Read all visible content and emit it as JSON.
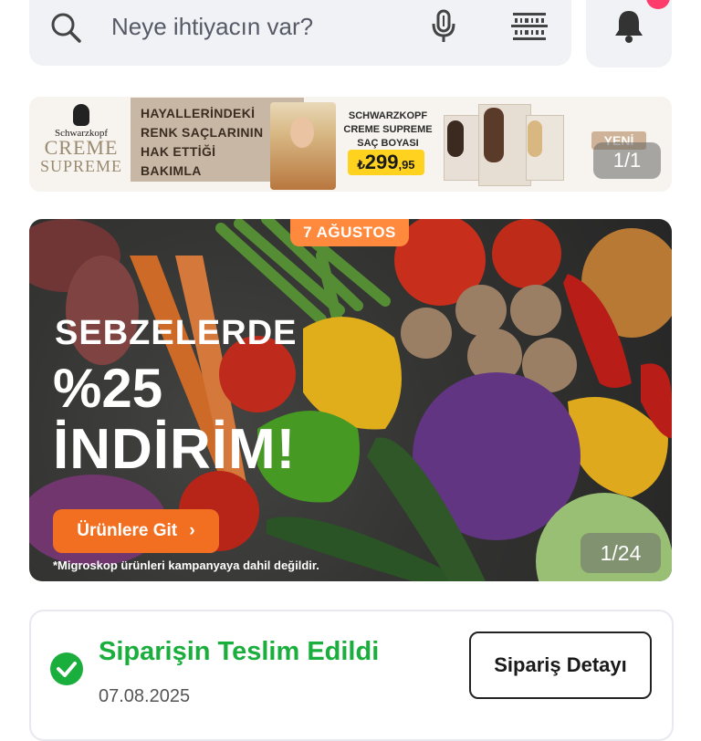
{
  "search": {
    "placeholder": "Neye ihtiyacın var?"
  },
  "icons": {
    "search": "search-icon",
    "mic": "microphone-icon",
    "barcode": "barcode-icon",
    "bell": "bell-icon",
    "check": "check-circle-icon",
    "chevron": "chevron-right-icon"
  },
  "ad": {
    "brand_line1": "Schwarzkopf",
    "brand_line2": "CREME",
    "brand_line3": "SUPREME",
    "tagline_1": "HAYALLERİNDEKİ",
    "tagline_2": "RENK SAÇLARININ",
    "tagline_3": "HAK ETTİĞİ",
    "tagline_4": "BAKIMLA",
    "product_1": "SCHWARZKOPF",
    "product_2": "CREME SUPREME",
    "product_3": "SAÇ BOYASI",
    "price_currency": "₺",
    "price_int": "299",
    "price_dec": ",95",
    "new_label": "YENİ",
    "counter": "1/1"
  },
  "hero": {
    "date": "7 AĞUSTOS",
    "line1": "SEBZELERDE",
    "line2": "%25",
    "line3": "İNDİRİM!",
    "cta": "Ürünlere Git",
    "disclaimer": "*Migroskop ürünleri kampanyaya dahil değildir.",
    "counter": "1/24"
  },
  "order": {
    "status": "Siparişin Teslim Edildi",
    "date": "07.08.2025",
    "detail_button": "Sipariş Detayı"
  },
  "colors": {
    "accent_orange": "#f26f21",
    "success_green": "#1aae3d",
    "badge_pink": "#ff3b6b",
    "price_yellow": "#ffd21f"
  }
}
